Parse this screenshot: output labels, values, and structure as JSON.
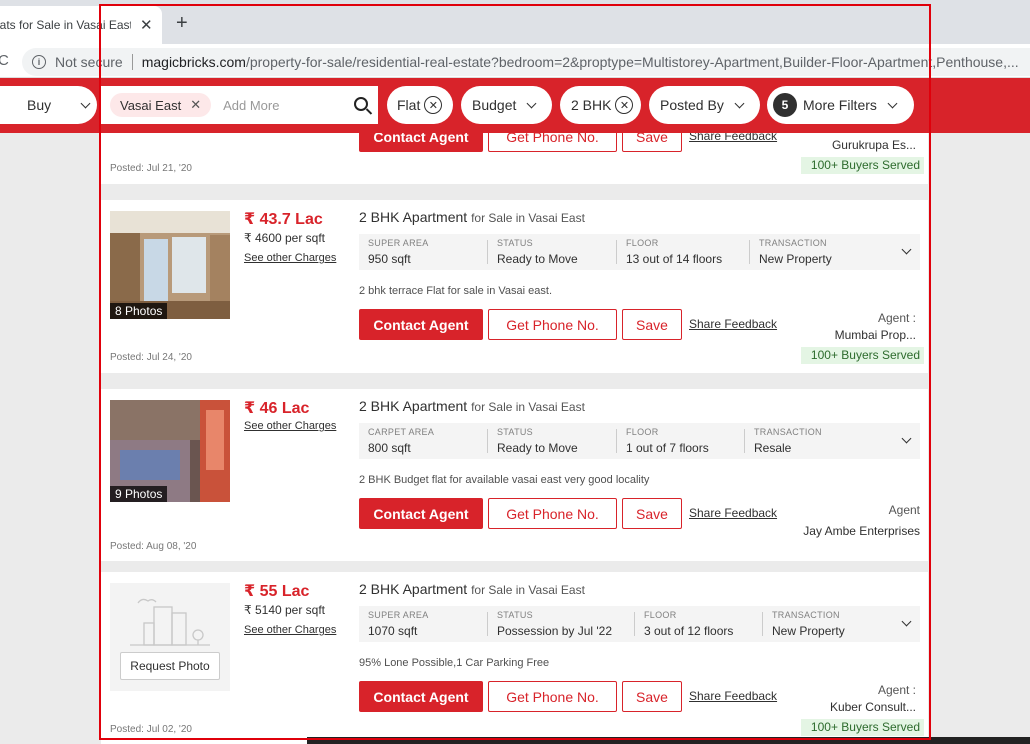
{
  "browser": {
    "tab_title": "lats for Sale in Vasai East, ",
    "tab_close": "✕",
    "new_tab": "+",
    "reload": "C",
    "not_secure": "Not secure",
    "url_host": "magicbricks.com",
    "url_path": "/property-for-sale/residential-real-estate?bedroom=2&proptype=Multistorey-Apartment,Builder-Floor-Apartment,Penthouse,..."
  },
  "filters": {
    "buy_label": "Buy",
    "location_chip": "Vasai East",
    "add_more_placeholder": "Add More",
    "flat_label": "Flat",
    "budget_label": "Budget",
    "bhk_label": "2 BHK",
    "posted_by_label": "Posted By",
    "more_filters_count": "5",
    "more_filters_label": "More Filters"
  },
  "listings": [
    {
      "partial": true,
      "contact_label": "Contact Agent",
      "phone_label": "Get Phone No.",
      "save_label": "Save",
      "share_label": "Share Feedback",
      "agent_name": "Gurukrupa Es...",
      "buyers_served": "100+ Buyers Served",
      "posted": "Posted: Jul 21, '20"
    },
    {
      "price": "₹ 43.7 Lac",
      "per_sqft": "₹ 4600 per sqft",
      "charges": "See other Charges",
      "photos": "8 Photos",
      "title": "2 BHK Apartment",
      "title_sub": "for Sale in Vasai East",
      "specs": [
        {
          "label": "SUPER AREA",
          "value": "950 sqft"
        },
        {
          "label": "STATUS",
          "value": "Ready to Move"
        },
        {
          "label": "FLOOR",
          "value": "13 out of 14 floors"
        },
        {
          "label": "TRANSACTION",
          "value": "New Property"
        }
      ],
      "description": "2 bhk terrace Flat for sale in Vasai east.",
      "contact_label": "Contact Agent",
      "phone_label": "Get Phone No.",
      "save_label": "Save",
      "share_label": "Share Feedback",
      "agent_label": "Agent :",
      "agent_name": "Mumbai Prop...",
      "buyers_served": "100+ Buyers Served",
      "posted": "Posted: Jul 24, '20"
    },
    {
      "price": "₹ 46 Lac",
      "charges": "See other Charges",
      "photos": "9 Photos",
      "title": "2 BHK Apartment",
      "title_sub": "for Sale in Vasai East",
      "specs": [
        {
          "label": "CARPET AREA",
          "value": "800 sqft"
        },
        {
          "label": "STATUS",
          "value": "Ready to Move"
        },
        {
          "label": "FLOOR",
          "value": "1 out of 7 floors"
        },
        {
          "label": "TRANSACTION",
          "value": "Resale"
        }
      ],
      "description": "2 BHK Budget flat for available vasai east very good locality",
      "contact_label": "Contact Agent",
      "phone_label": "Get Phone No.",
      "save_label": "Save",
      "share_label": "Share Feedback",
      "agent_label": "Agent",
      "agent_name": "Jay Ambe Enterprises",
      "posted": "Posted: Aug 08, '20"
    },
    {
      "price": "₹ 55 Lac",
      "per_sqft": "₹ 5140 per sqft",
      "charges": "See other Charges",
      "request_photo": "Request Photo",
      "title": "2 BHK Apartment",
      "title_sub": "for Sale in Vasai East",
      "specs": [
        {
          "label": "SUPER AREA",
          "value": "1070 sqft"
        },
        {
          "label": "STATUS",
          "value": "Possession by Jul '22"
        },
        {
          "label": "FLOOR",
          "value": "3 out of 12 floors"
        },
        {
          "label": "TRANSACTION",
          "value": "New Property"
        }
      ],
      "description": "95% Lone Possible,1 Car Parking Free",
      "contact_label": "Contact Agent",
      "phone_label": "Get Phone No.",
      "save_label": "Save",
      "share_label": "Share Feedback",
      "agent_label": "Agent :",
      "agent_name": "Kuber Consult...",
      "buyers_served": "100+ Buyers Served",
      "posted": "Posted: Jul 02, '20"
    }
  ]
}
